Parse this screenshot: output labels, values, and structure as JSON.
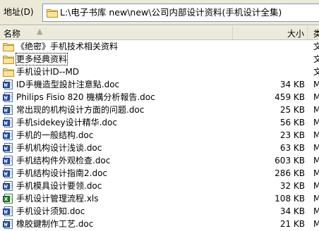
{
  "address": {
    "label": "地址(D)",
    "path": "L:\\电子书库 new\\new\\公司内部设计资料(手机设计全集)"
  },
  "columns": {
    "name": "名称",
    "sort_indicator": "▲",
    "size": "大小",
    "type": "类"
  },
  "files": [
    {
      "name": "《绝密》手机技术相关资料",
      "size": "",
      "type": "文",
      "icon": "folder-icon",
      "selected": false
    },
    {
      "name": "更多经典资料",
      "size": "",
      "type": "文",
      "icon": "folder-icon",
      "selected": true
    },
    {
      "name": "手机设计ID--MD",
      "size": "",
      "type": "文",
      "icon": "folder-icon",
      "selected": false
    },
    {
      "name": "ID手機造型設計注意點.doc",
      "size": "34 KB",
      "type": "M",
      "icon": "word-doc-icon",
      "selected": false
    },
    {
      "name": "Philips Fisio 820 機構分析報告.doc",
      "size": "459 KB",
      "type": "M",
      "icon": "word-doc-icon",
      "selected": false
    },
    {
      "name": "常出现的机构设计方面的问题.doc",
      "size": "25 KB",
      "type": "M",
      "icon": "word-doc-icon",
      "selected": false
    },
    {
      "name": "手机sidekey设计精华.doc",
      "size": "56 KB",
      "type": "M",
      "icon": "word-doc-icon",
      "selected": false
    },
    {
      "name": "手机的一般结构.doc",
      "size": "23 KB",
      "type": "M",
      "icon": "word-doc-icon",
      "selected": false
    },
    {
      "name": "手机机构设计浅谈.doc",
      "size": "63 KB",
      "type": "M",
      "icon": "word-doc-icon",
      "selected": false
    },
    {
      "name": "手机结构件外观检查.doc",
      "size": "603 KB",
      "type": "M",
      "icon": "word-doc-icon",
      "selected": false
    },
    {
      "name": "手机结构设计指南2.doc",
      "size": "286 KB",
      "type": "M",
      "icon": "word-doc-icon",
      "selected": false
    },
    {
      "name": "手机模具设计要领.doc",
      "size": "32 KB",
      "type": "M",
      "icon": "word-doc-icon",
      "selected": false
    },
    {
      "name": "手机设计管理流程.xls",
      "size": "108 KB",
      "type": "M",
      "icon": "excel-xls-icon",
      "selected": false
    },
    {
      "name": "手机设计须知.doc",
      "size": "34 KB",
      "type": "M",
      "icon": "word-doc-icon",
      "selected": false
    },
    {
      "name": "橡胶鍵制作工艺.doc",
      "size": "21 KB",
      "type": "M",
      "icon": "word-doc-icon",
      "selected": false
    }
  ]
}
